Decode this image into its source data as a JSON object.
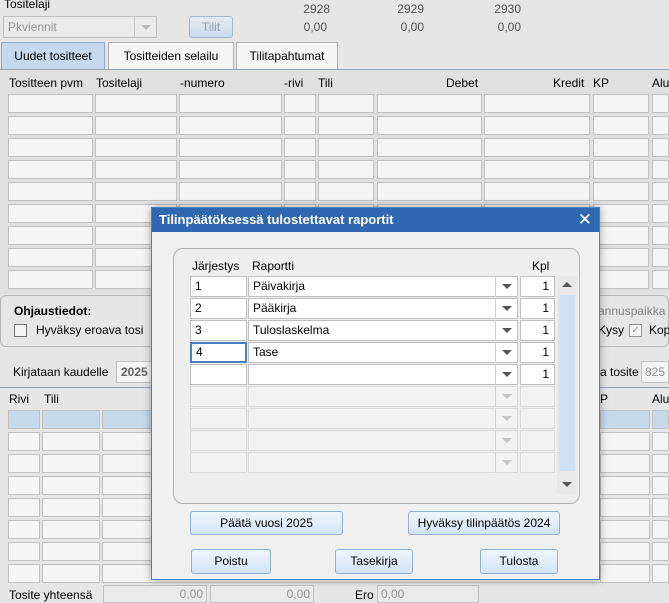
{
  "top": {
    "tositelaji_label": "Tositelaji",
    "tositelaji_value": "Pkviennit",
    "tilit_button": "Tilit",
    "cols": [
      {
        "head": "2928",
        "val": "0,00"
      },
      {
        "head": "2929",
        "val": "0,00"
      },
      {
        "head": "2930",
        "val": "0,00"
      }
    ]
  },
  "tabs": [
    "Uudet tositteet",
    "Tositteiden selailu",
    "Tilitapahtumat"
  ],
  "grid1": {
    "headers": [
      "Tositteen pvm",
      "Tositelaji",
      "-numero",
      "-rivi",
      "Tili",
      "Debet",
      "Kredit",
      "KP",
      "Alu"
    ]
  },
  "ohjaus": {
    "title": "Ohjaustiedot:",
    "hyvaksy_label": "Hyväksy eroava tosi",
    "right_label": "annuspaikka",
    "kysy_label": "Kysy",
    "kop_label": "Kop"
  },
  "kirjataan": {
    "label": "Kirjataan kaudelle",
    "value": "2025",
    "tosite_label": "a tosite",
    "tosite_value": "825"
  },
  "grid2": {
    "headers": [
      "Rivi",
      "Tili",
      "P",
      "Alu"
    ]
  },
  "footer": {
    "label": "Tosite yhteensä",
    "val1": "0,00",
    "val2": "0,00",
    "ero_label": "Ero",
    "ero_value": "0,00"
  },
  "dialog": {
    "title": "Tilinpäätöksessä tulostettavat raportit",
    "headers": {
      "jarjestys": "Järjestys",
      "raportti": "Raportti",
      "kpl": "Kpl"
    },
    "rows": [
      {
        "jarjestys": "1",
        "raportti": "Päivakirja",
        "kpl": "1"
      },
      {
        "jarjestys": "2",
        "raportti": "Pääkirja",
        "kpl": "1"
      },
      {
        "jarjestys": "3",
        "raportti": "Tuloslaskelma",
        "kpl": "1"
      },
      {
        "jarjestys": "4",
        "raportti": "Tase",
        "kpl": "1"
      },
      {
        "jarjestys": "",
        "raportti": "",
        "kpl": "1"
      }
    ],
    "buttons": {
      "paata": "Päätä vuosi 2025",
      "hyvaksy": "Hyväksy tilinpäätös 2024",
      "poistu": "Poistu",
      "tasekirja": "Tasekirja",
      "tulosta": "Tulosta"
    }
  }
}
